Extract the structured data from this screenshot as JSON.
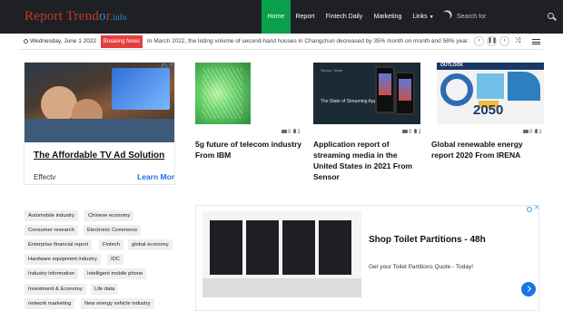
{
  "header": {
    "logo": {
      "part1": "Report ",
      "part2": "Trend",
      "part3": "o",
      "part4": "r",
      "tld": ".info"
    },
    "nav": [
      {
        "label": "Home"
      },
      {
        "label": "Report"
      },
      {
        "label": "Fintech Daily"
      },
      {
        "label": "Marketing"
      },
      {
        "label": "Links"
      }
    ],
    "search_placeholder": "Search for"
  },
  "breaking_bar": {
    "date": "Wednesday, June 1 2022",
    "label": "Breaking News",
    "ticker": "In March 2022, the listing volume of second-hand houses in Changchun decreased by 35% month on month and 58% year ..."
  },
  "ad_left": {
    "title": "The Affordable TV Ad Solution",
    "brand": "Effectv",
    "cta": "Learn More"
  },
  "posts": [
    {
      "title": "5g future of telecom industry From IBM",
      "comments": "0",
      "views": "2"
    },
    {
      "title": "Application report of streaming media in the United States in 2021 From Sensor",
      "comments": "0",
      "views": "1",
      "thumb_text": "The State of Streaming Apps",
      "thumb_brand": "Sensor Tower"
    },
    {
      "title": "Global renewable energy report 2020 From IRENA",
      "comments": "0",
      "views": "1",
      "thumb_band": "OUTLOOK",
      "thumb_year": "2050"
    }
  ],
  "tags": [
    "Automobile industry",
    "Chinese economy",
    "Consumer research",
    "Electronic Commerce",
    "Enterprise financial report",
    "Fintech",
    "global economy",
    "Hardware equipment industry",
    "IDC",
    "Industry information",
    "Intelligent mobile phone",
    "Investment & Economy",
    "Life data",
    "network marketing",
    "New energy vehicle industry"
  ],
  "ad_bottom": {
    "title": "Shop Toilet Partitions - 48h",
    "desc": "Get your Toilet Partitions Quote - Today!"
  }
}
